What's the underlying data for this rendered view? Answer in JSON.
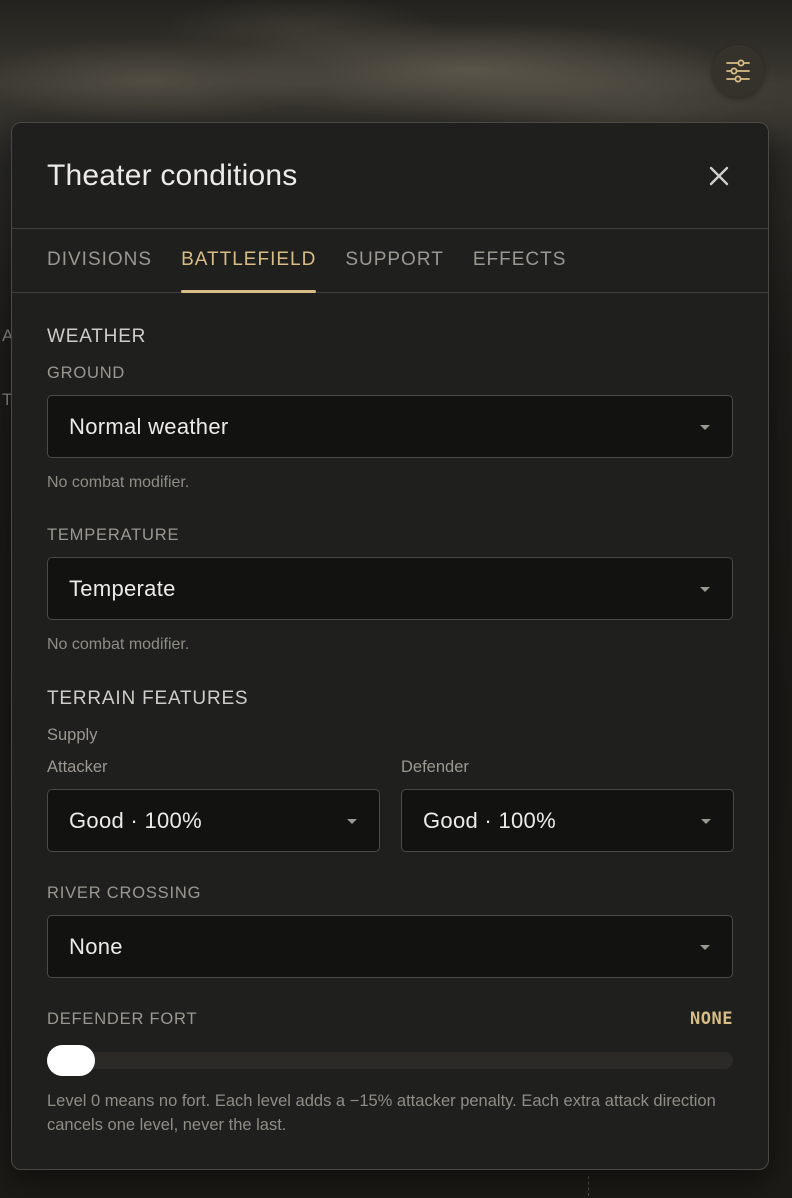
{
  "panel": {
    "title": "Theater conditions"
  },
  "tabs": [
    {
      "label": "DIVISIONS",
      "active": false
    },
    {
      "label": "BATTLEFIELD",
      "active": true
    },
    {
      "label": "SUPPORT",
      "active": false
    },
    {
      "label": "EFFECTS",
      "active": false
    }
  ],
  "weather": {
    "section_title": "WEATHER",
    "ground": {
      "label": "GROUND",
      "selected": "Normal weather",
      "hint": "No combat modifier."
    },
    "temperature": {
      "label": "TEMPERATURE",
      "selected": "Temperate",
      "hint": "No combat modifier."
    }
  },
  "terrain": {
    "section_title": "TERRAIN FEATURES",
    "supply_label": "Supply",
    "attacker": {
      "label": "Attacker",
      "selected": "Good · 100%"
    },
    "defender": {
      "label": "Defender",
      "selected": "Good · 100%"
    },
    "river": {
      "label": "RIVER CROSSING",
      "selected": "None"
    },
    "fort": {
      "label": "DEFENDER FORT",
      "value_text": "NONE",
      "level": 0,
      "footnote": "Level 0 means no fort. Each level adds a −15% attacker penalty. Each extra attack direction cancels one level, never the last."
    }
  },
  "background": {
    "peek_letters": [
      "A",
      "T"
    ]
  },
  "colors": {
    "accent": "#d8bd86",
    "panel_bg": "#1f1f1d",
    "select_bg": "#121211",
    "muted_text": "#9a9891"
  },
  "icons": {
    "fab": "sliders-icon",
    "close": "close-icon",
    "caret": "caret-down-icon"
  }
}
